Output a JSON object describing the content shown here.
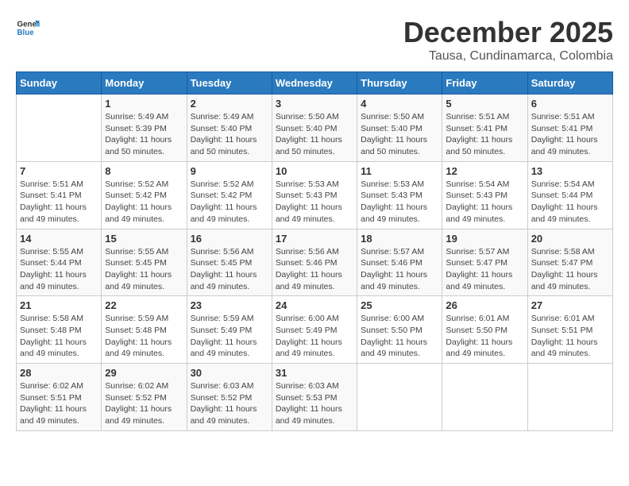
{
  "header": {
    "logo_general": "General",
    "logo_blue": "Blue",
    "title": "December 2025",
    "subtitle": "Tausa, Cundinamarca, Colombia"
  },
  "calendar": {
    "days_of_week": [
      "Sunday",
      "Monday",
      "Tuesday",
      "Wednesday",
      "Thursday",
      "Friday",
      "Saturday"
    ],
    "weeks": [
      [
        {
          "day": "",
          "info": ""
        },
        {
          "day": "1",
          "info": "Sunrise: 5:49 AM\nSunset: 5:39 PM\nDaylight: 11 hours\nand 50 minutes."
        },
        {
          "day": "2",
          "info": "Sunrise: 5:49 AM\nSunset: 5:40 PM\nDaylight: 11 hours\nand 50 minutes."
        },
        {
          "day": "3",
          "info": "Sunrise: 5:50 AM\nSunset: 5:40 PM\nDaylight: 11 hours\nand 50 minutes."
        },
        {
          "day": "4",
          "info": "Sunrise: 5:50 AM\nSunset: 5:40 PM\nDaylight: 11 hours\nand 50 minutes."
        },
        {
          "day": "5",
          "info": "Sunrise: 5:51 AM\nSunset: 5:41 PM\nDaylight: 11 hours\nand 50 minutes."
        },
        {
          "day": "6",
          "info": "Sunrise: 5:51 AM\nSunset: 5:41 PM\nDaylight: 11 hours\nand 49 minutes."
        }
      ],
      [
        {
          "day": "7",
          "info": "Sunrise: 5:51 AM\nSunset: 5:41 PM\nDaylight: 11 hours\nand 49 minutes."
        },
        {
          "day": "8",
          "info": "Sunrise: 5:52 AM\nSunset: 5:42 PM\nDaylight: 11 hours\nand 49 minutes."
        },
        {
          "day": "9",
          "info": "Sunrise: 5:52 AM\nSunset: 5:42 PM\nDaylight: 11 hours\nand 49 minutes."
        },
        {
          "day": "10",
          "info": "Sunrise: 5:53 AM\nSunset: 5:43 PM\nDaylight: 11 hours\nand 49 minutes."
        },
        {
          "day": "11",
          "info": "Sunrise: 5:53 AM\nSunset: 5:43 PM\nDaylight: 11 hours\nand 49 minutes."
        },
        {
          "day": "12",
          "info": "Sunrise: 5:54 AM\nSunset: 5:43 PM\nDaylight: 11 hours\nand 49 minutes."
        },
        {
          "day": "13",
          "info": "Sunrise: 5:54 AM\nSunset: 5:44 PM\nDaylight: 11 hours\nand 49 minutes."
        }
      ],
      [
        {
          "day": "14",
          "info": "Sunrise: 5:55 AM\nSunset: 5:44 PM\nDaylight: 11 hours\nand 49 minutes."
        },
        {
          "day": "15",
          "info": "Sunrise: 5:55 AM\nSunset: 5:45 PM\nDaylight: 11 hours\nand 49 minutes."
        },
        {
          "day": "16",
          "info": "Sunrise: 5:56 AM\nSunset: 5:45 PM\nDaylight: 11 hours\nand 49 minutes."
        },
        {
          "day": "17",
          "info": "Sunrise: 5:56 AM\nSunset: 5:46 PM\nDaylight: 11 hours\nand 49 minutes."
        },
        {
          "day": "18",
          "info": "Sunrise: 5:57 AM\nSunset: 5:46 PM\nDaylight: 11 hours\nand 49 minutes."
        },
        {
          "day": "19",
          "info": "Sunrise: 5:57 AM\nSunset: 5:47 PM\nDaylight: 11 hours\nand 49 minutes."
        },
        {
          "day": "20",
          "info": "Sunrise: 5:58 AM\nSunset: 5:47 PM\nDaylight: 11 hours\nand 49 minutes."
        }
      ],
      [
        {
          "day": "21",
          "info": "Sunrise: 5:58 AM\nSunset: 5:48 PM\nDaylight: 11 hours\nand 49 minutes."
        },
        {
          "day": "22",
          "info": "Sunrise: 5:59 AM\nSunset: 5:48 PM\nDaylight: 11 hours\nand 49 minutes."
        },
        {
          "day": "23",
          "info": "Sunrise: 5:59 AM\nSunset: 5:49 PM\nDaylight: 11 hours\nand 49 minutes."
        },
        {
          "day": "24",
          "info": "Sunrise: 6:00 AM\nSunset: 5:49 PM\nDaylight: 11 hours\nand 49 minutes."
        },
        {
          "day": "25",
          "info": "Sunrise: 6:00 AM\nSunset: 5:50 PM\nDaylight: 11 hours\nand 49 minutes."
        },
        {
          "day": "26",
          "info": "Sunrise: 6:01 AM\nSunset: 5:50 PM\nDaylight: 11 hours\nand 49 minutes."
        },
        {
          "day": "27",
          "info": "Sunrise: 6:01 AM\nSunset: 5:51 PM\nDaylight: 11 hours\nand 49 minutes."
        }
      ],
      [
        {
          "day": "28",
          "info": "Sunrise: 6:02 AM\nSunset: 5:51 PM\nDaylight: 11 hours\nand 49 minutes."
        },
        {
          "day": "29",
          "info": "Sunrise: 6:02 AM\nSunset: 5:52 PM\nDaylight: 11 hours\nand 49 minutes."
        },
        {
          "day": "30",
          "info": "Sunrise: 6:03 AM\nSunset: 5:52 PM\nDaylight: 11 hours\nand 49 minutes."
        },
        {
          "day": "31",
          "info": "Sunrise: 6:03 AM\nSunset: 5:53 PM\nDaylight: 11 hours\nand 49 minutes."
        },
        {
          "day": "",
          "info": ""
        },
        {
          "day": "",
          "info": ""
        },
        {
          "day": "",
          "info": ""
        }
      ]
    ]
  }
}
